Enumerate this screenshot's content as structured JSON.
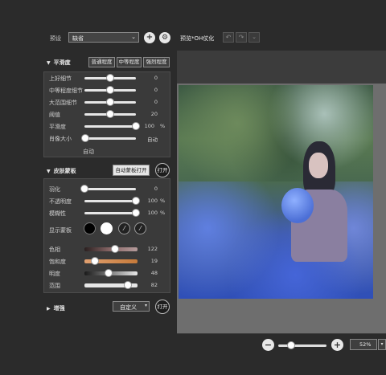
{
  "preset": {
    "label": "预设",
    "value": "缺省"
  },
  "preview": {
    "label": "预览*OH仗化"
  },
  "smoothing": {
    "title": "平滑度",
    "buttons": [
      "普通程度",
      "中等程度",
      "强烈程度"
    ],
    "sliders": [
      {
        "label": "上好细节",
        "value": "0",
        "unit": "",
        "pct": 0.5
      },
      {
        "label": "中等程度细节",
        "value": "0",
        "unit": "",
        "pct": 0.5
      },
      {
        "label": "大范围细节",
        "value": "0",
        "unit": "",
        "pct": 0.5
      },
      {
        "label": "阈值",
        "value": "20",
        "unit": "",
        "pct": 0.5
      },
      {
        "label": "平滑度",
        "value": "100",
        "unit": "%",
        "pct": 1.0
      },
      {
        "label": "肖像大小",
        "value": "自动",
        "unit": "",
        "pct": 0.02
      }
    ],
    "auto_label": "自动"
  },
  "mask": {
    "title": "皮肤蒙板",
    "auto_button": "自动蒙板打开",
    "toggle": "打开",
    "sliders": [
      {
        "label": "羽化",
        "value": "0",
        "unit": "",
        "pct": 0.0
      },
      {
        "label": "不透明度",
        "value": "100",
        "unit": "%",
        "pct": 1.0
      },
      {
        "label": "模糊性",
        "value": "100",
        "unit": "%",
        "pct": 1.0
      }
    ],
    "show_mask_label": "显示蒙板",
    "color_sliders": [
      {
        "label": "色相",
        "value": "122",
        "pct": 0.58
      },
      {
        "label": "饱和度",
        "value": "19",
        "pct": 0.2
      },
      {
        "label": "明度",
        "value": "48",
        "pct": 0.46
      },
      {
        "label": "范围",
        "value": "82",
        "pct": 0.82
      }
    ]
  },
  "enhance": {
    "title": "增强",
    "select": "自定义",
    "toggle": "打开"
  },
  "zoom": {
    "value": "52%"
  },
  "colors": {
    "bg": "#2b2b2b",
    "panel": "#3a3a3a",
    "canvas": "#6e6e6e"
  }
}
